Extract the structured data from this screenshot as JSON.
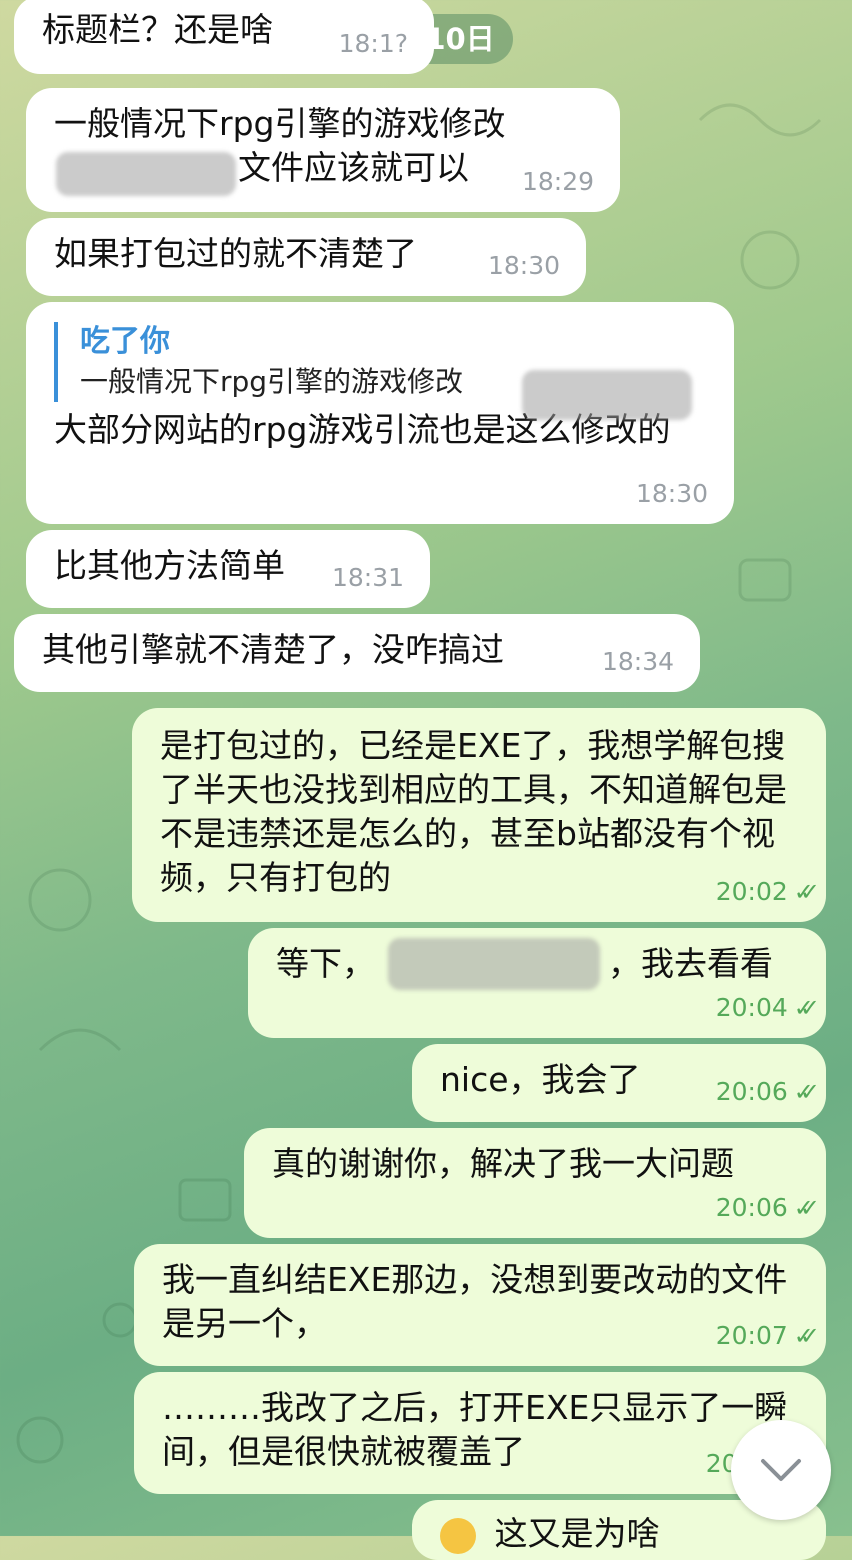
{
  "date_chip": "11月10日",
  "messages": [
    {
      "text": "标题栏？还是啥",
      "time": "18:1?"
    },
    {
      "line1": "一般情况下rpg引擎的游戏修改",
      "line2": "文件应该就可以",
      "time": "18:29"
    },
    {
      "text": "如果打包过的就不清楚了",
      "time": "18:30"
    },
    {
      "reply_name": "吃了你",
      "reply_text": "一般情况下rpg引擎的游戏修改",
      "text": "大部分网站的rpg游戏引流也是这么修改的",
      "time": "18:30"
    },
    {
      "text": "比其他方法简单",
      "time": "18:31"
    },
    {
      "text": "其他引擎就不清楚了，没咋搞过",
      "time": "18:34"
    },
    {
      "text": "是打包过的，已经是EXE了，我想学解包搜了半天也没找到相应的工具，不知道解包是不是违禁还是怎么的，甚至b站都没有个视频，只有打包的",
      "time": "20:02"
    },
    {
      "prefix": "等下，",
      "suffix": "，我去看看",
      "time": "20:04"
    },
    {
      "text": "nice，我会了",
      "time": "20:06"
    },
    {
      "text": "真的谢谢你，解决了我一大问题",
      "time": "20:06"
    },
    {
      "text": "我一直纠结EXE那边，没想到要改动的文件是另一个，",
      "time": "20:07"
    },
    {
      "text": "………我改了之后，打开EXE只显示了一瞬间，但是很快就被覆盖了",
      "time": "20:"
    },
    {
      "text": "这又是为啥"
    }
  ],
  "read_mark": "✓✓",
  "scroll_icon": "chevron-down-icon"
}
